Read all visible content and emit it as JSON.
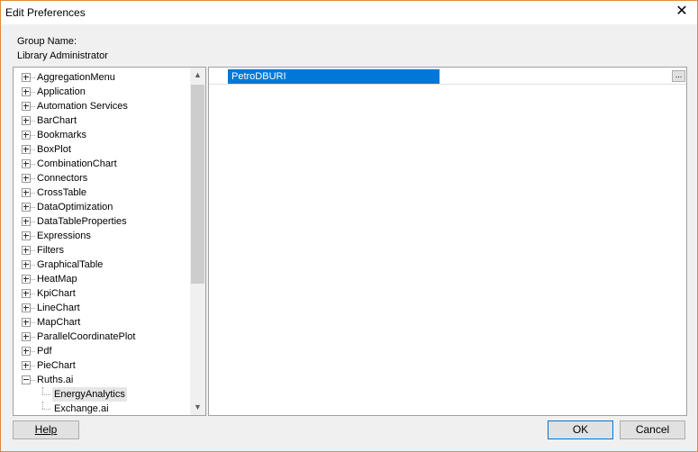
{
  "window": {
    "title": "Edit Preferences",
    "close_symbol": "✕"
  },
  "group": {
    "label": "Group Name:",
    "value": "Library Administrator"
  },
  "tree": {
    "items": [
      {
        "label": "AggregationMenu",
        "expander": "plus"
      },
      {
        "label": "Application",
        "expander": "plus"
      },
      {
        "label": "Automation Services",
        "expander": "plus"
      },
      {
        "label": "BarChart",
        "expander": "plus"
      },
      {
        "label": "Bookmarks",
        "expander": "plus"
      },
      {
        "label": "BoxPlot",
        "expander": "plus"
      },
      {
        "label": "CombinationChart",
        "expander": "plus"
      },
      {
        "label": "Connectors",
        "expander": "plus"
      },
      {
        "label": "CrossTable",
        "expander": "plus"
      },
      {
        "label": "DataOptimization",
        "expander": "plus"
      },
      {
        "label": "DataTableProperties",
        "expander": "plus"
      },
      {
        "label": "Expressions",
        "expander": "plus"
      },
      {
        "label": "Filters",
        "expander": "plus"
      },
      {
        "label": "GraphicalTable",
        "expander": "plus"
      },
      {
        "label": "HeatMap",
        "expander": "plus"
      },
      {
        "label": "KpiChart",
        "expander": "plus"
      },
      {
        "label": "LineChart",
        "expander": "plus"
      },
      {
        "label": "MapChart",
        "expander": "plus"
      },
      {
        "label": "ParallelCoordinatePlot",
        "expander": "plus"
      },
      {
        "label": "Pdf",
        "expander": "plus"
      },
      {
        "label": "PieChart",
        "expander": "plus"
      },
      {
        "label": "Ruths.ai",
        "expander": "minus"
      },
      {
        "label": "EnergyAnalytics",
        "child": true,
        "selected": true
      },
      {
        "label": "Exchange.ai",
        "child": true
      }
    ]
  },
  "property": {
    "name": "PetroDBURI",
    "value": "",
    "browse_label": "..."
  },
  "buttons": {
    "help": "Help",
    "ok": "OK",
    "cancel": "Cancel"
  },
  "colors": {
    "selection": "#0078d7",
    "window_border": "#e08a3c"
  }
}
